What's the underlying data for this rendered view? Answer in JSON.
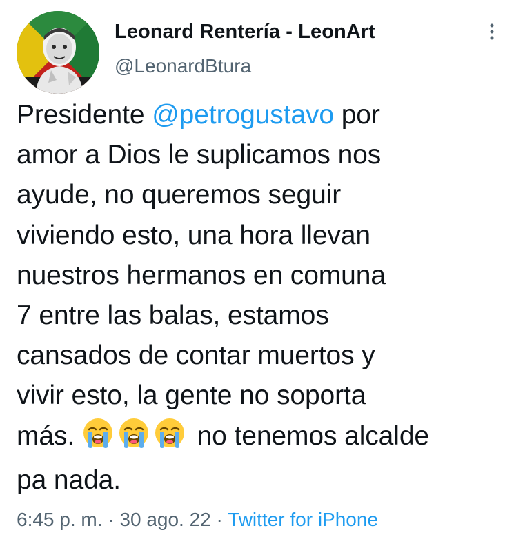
{
  "author": {
    "name": "Leonard Rentería - LeonArt",
    "handle": "@LeonardBtura",
    "avatar_icon": "profile-photo"
  },
  "tweet": {
    "text_before_mention": "Presidente ",
    "mention": "@petrogustavo",
    "text_after_mention": " por\namor a Dios le suplicamos nos\nayude, no queremos seguir\nviviendo esto, una hora llevan\nnuestros hermanos en comuna\n7 entre las balas, estamos\ncansados de contar muertos y\nvivir esto, la gente no soporta\nmás. ",
    "emojis": [
      "loudly-crying-face",
      "loudly-crying-face",
      "loudly-crying-face"
    ],
    "text_after_emojis": " no tenemos alcalde\npa nada."
  },
  "meta": {
    "time": "6:45 p. m.",
    "separator": " · ",
    "date": "30 ago. 22",
    "source": "Twitter for iPhone"
  },
  "icons": {
    "more": "more-vertical-icon"
  },
  "colors": {
    "text": "#0f1419",
    "secondary": "#536471",
    "accent": "#1d9bf0",
    "divider": "#eff3f4"
  }
}
